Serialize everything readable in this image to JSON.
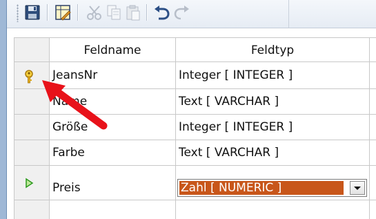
{
  "toolbar": {
    "buttons": [
      {
        "name": "save",
        "icon": "save-icon",
        "enabled": true
      },
      {
        "name": "design",
        "icon": "table-design-icon",
        "enabled": true
      },
      {
        "name": "cut",
        "icon": "cut-icon",
        "enabled": false
      },
      {
        "name": "copy",
        "icon": "copy-icon",
        "enabled": false
      },
      {
        "name": "paste",
        "icon": "paste-icon",
        "enabled": false
      },
      {
        "name": "undo",
        "icon": "undo-icon",
        "enabled": true
      },
      {
        "name": "redo",
        "icon": "redo-icon",
        "enabled": false
      }
    ]
  },
  "table": {
    "headers": {
      "field_name": "Feldname",
      "field_type": "Feldtyp"
    },
    "rows": [
      {
        "name": "JeansNr",
        "type": "Integer [ INTEGER ]",
        "marker": "primary-key"
      },
      {
        "name": "Name",
        "type": "Text [ VARCHAR ]",
        "marker": ""
      },
      {
        "name": "Größe",
        "type": "Integer [ INTEGER ]",
        "marker": ""
      },
      {
        "name": "Farbe",
        "type": "Text [ VARCHAR ]",
        "marker": ""
      },
      {
        "name": "Preis",
        "type": "Zahl [ NUMERIC ]",
        "marker": "current-row"
      }
    ],
    "selected_type_value": "Zahl [ NUMERIC ]"
  },
  "annotation": {
    "color": "#e8121a",
    "points_to": "primary-key-icon"
  },
  "colors": {
    "selection": "#c8561a",
    "key": "#e0a81c",
    "current_row": "#2c9a1e"
  }
}
